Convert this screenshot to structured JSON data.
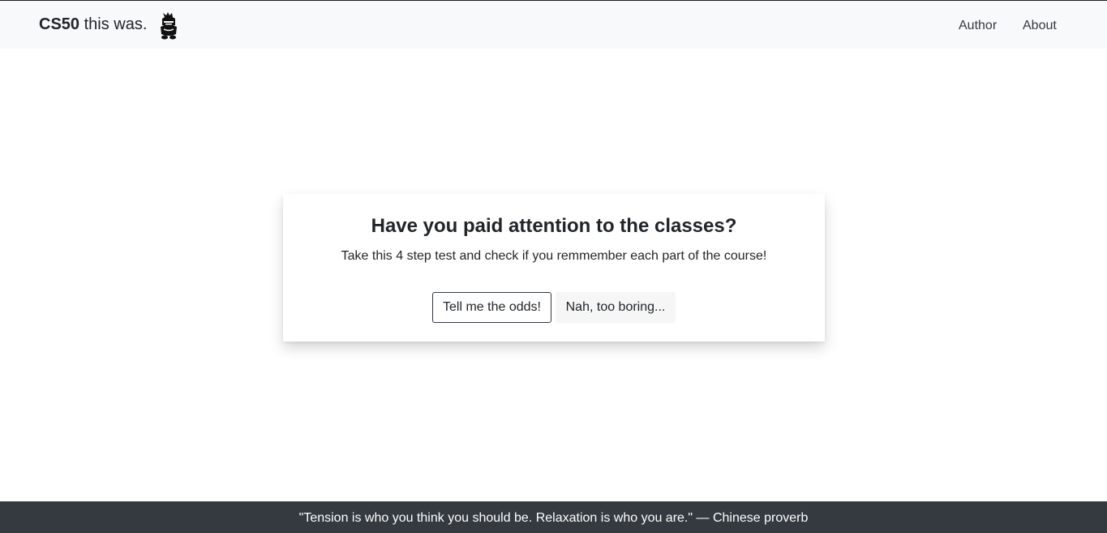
{
  "navbar": {
    "brand_strong": "CS50",
    "brand_rest": " this was.",
    "logo_icon": "knight-helmet-icon",
    "links": [
      {
        "label": "Author"
      },
      {
        "label": "About"
      }
    ]
  },
  "card": {
    "title": "Have you paid attention to the classes?",
    "text": "Take this 4 step test and check if you remmember each part of the course!",
    "primary_button": "Tell me the odds!",
    "secondary_button": "Nah, too boring..."
  },
  "footer": {
    "quote": "\"Tension is who you think you should be. Relaxation is who you are.\" — Chinese proverb"
  },
  "colors": {
    "navbar_bg": "#f8f9fa",
    "footer_bg": "#343a40",
    "text": "#212529"
  }
}
